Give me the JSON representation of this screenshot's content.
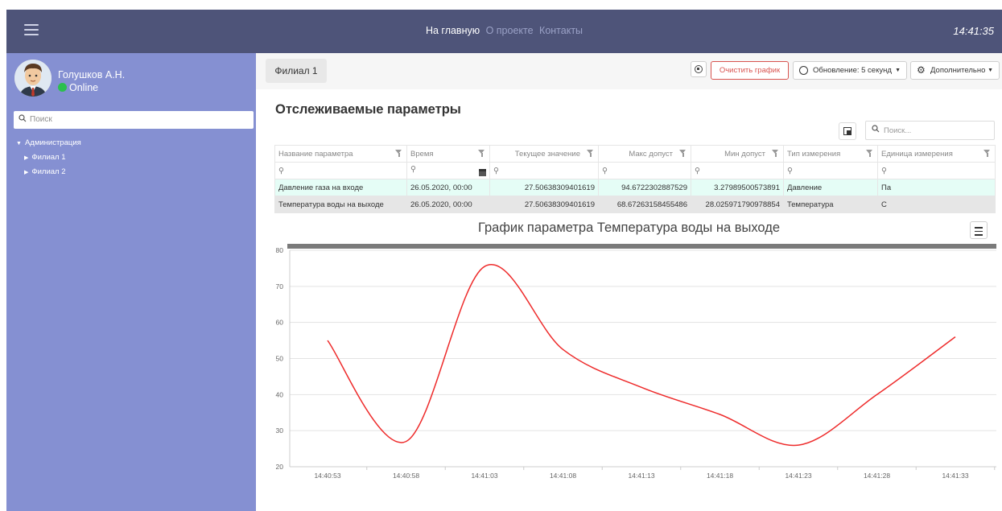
{
  "topbar": {
    "nav": [
      "На главную",
      "О проекте",
      "Контакты"
    ],
    "clock": "14:41:35"
  },
  "sidebar": {
    "user_name": "Голушков А.Н.",
    "status": "Online",
    "search_placeholder": "Поиск",
    "tree": [
      {
        "label": "Администрация",
        "children": [
          {
            "label": "Филиал 1"
          },
          {
            "label": "Филиал 2"
          }
        ]
      }
    ]
  },
  "toolbar": {
    "branch": "Филиал 1",
    "clear_label": "Очистить график",
    "refresh_label": "Обновление: 5 секунд",
    "more_label": "Дополнительно"
  },
  "main": {
    "title": "Отслеживаемые параметры",
    "search_placeholder": "Поиск..."
  },
  "table": {
    "headers": [
      "Название параметра",
      "Время",
      "Текущее значение",
      "Макс допуст",
      "Мин допуст",
      "Тип измерения",
      "Единица измерения"
    ],
    "rows": [
      [
        "Давление газа на входе",
        "26.05.2020, 00:00",
        "27.50638309401619",
        "94.6722302887529",
        "3.27989500573891",
        "Давление",
        "Па"
      ],
      [
        "Температура воды на выходе",
        "26.05.2020, 00:00",
        "27.50638309401619",
        "68.67263158455486",
        "28.025971790978854",
        "Температура",
        "С"
      ]
    ]
  },
  "chart_data": {
    "type": "line",
    "title": "График параметра Температура воды на выходе",
    "x": [
      "14:40:53",
      "14:40:58",
      "14:41:03",
      "14:41:08",
      "14:41:13",
      "14:41:18",
      "14:41:23",
      "14:41:28",
      "14:41:33"
    ],
    "values": [
      55,
      27,
      75.5,
      52.5,
      42,
      34.5,
      26,
      40,
      56
    ],
    "ylim": [
      20,
      80
    ],
    "yticks": [
      20,
      30,
      40,
      50,
      60,
      70,
      80
    ],
    "line_color": "#ee2b2b",
    "grid": true
  }
}
